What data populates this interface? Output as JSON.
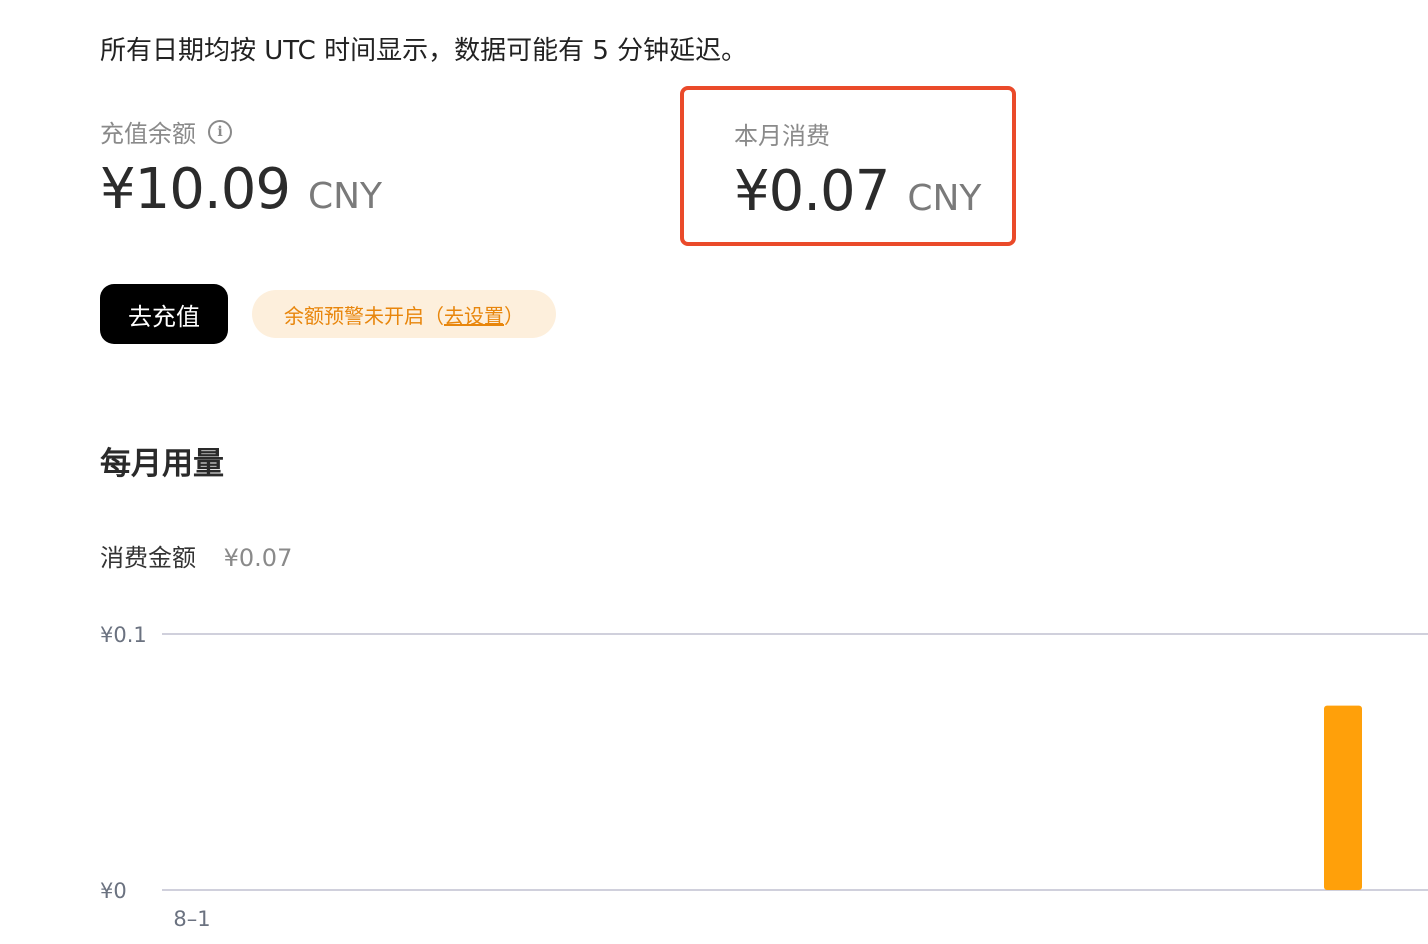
{
  "notice": "所有日期均按 UTC 时间显示，数据可能有 5 分钟延迟。",
  "balance": {
    "label": "充值余额",
    "amount": "¥10.09",
    "currency": "CNY"
  },
  "month_spend": {
    "label": "本月消费",
    "amount": "¥0.07",
    "currency": "CNY"
  },
  "actions": {
    "topup_label": "去充值",
    "alert_text": "余额预警未开启（",
    "alert_link": "去设置",
    "alert_suffix": "）"
  },
  "usage": {
    "title": "每月用量",
    "summary_label": "消费金额",
    "summary_value": "¥0.07"
  },
  "colors": {
    "accent": "#ffa00a",
    "highlight_border": "#ea4a2a",
    "grid": "#d0d0dc"
  },
  "chart_data": {
    "type": "bar",
    "x_tick_labels": [
      "8–1"
    ],
    "y_tick_labels": [
      "¥0.1",
      "¥0"
    ],
    "ylim": [
      0,
      0.1
    ],
    "days_in_period": 31,
    "values": [
      0,
      0,
      0,
      0,
      0,
      0,
      0,
      0,
      0,
      0,
      0,
      0,
      0,
      0,
      0,
      0,
      0,
      0,
      0,
      0,
      0,
      0,
      0,
      0,
      0,
      0,
      0,
      0,
      0,
      0.072,
      0
    ],
    "grid": true,
    "legend": "none"
  }
}
